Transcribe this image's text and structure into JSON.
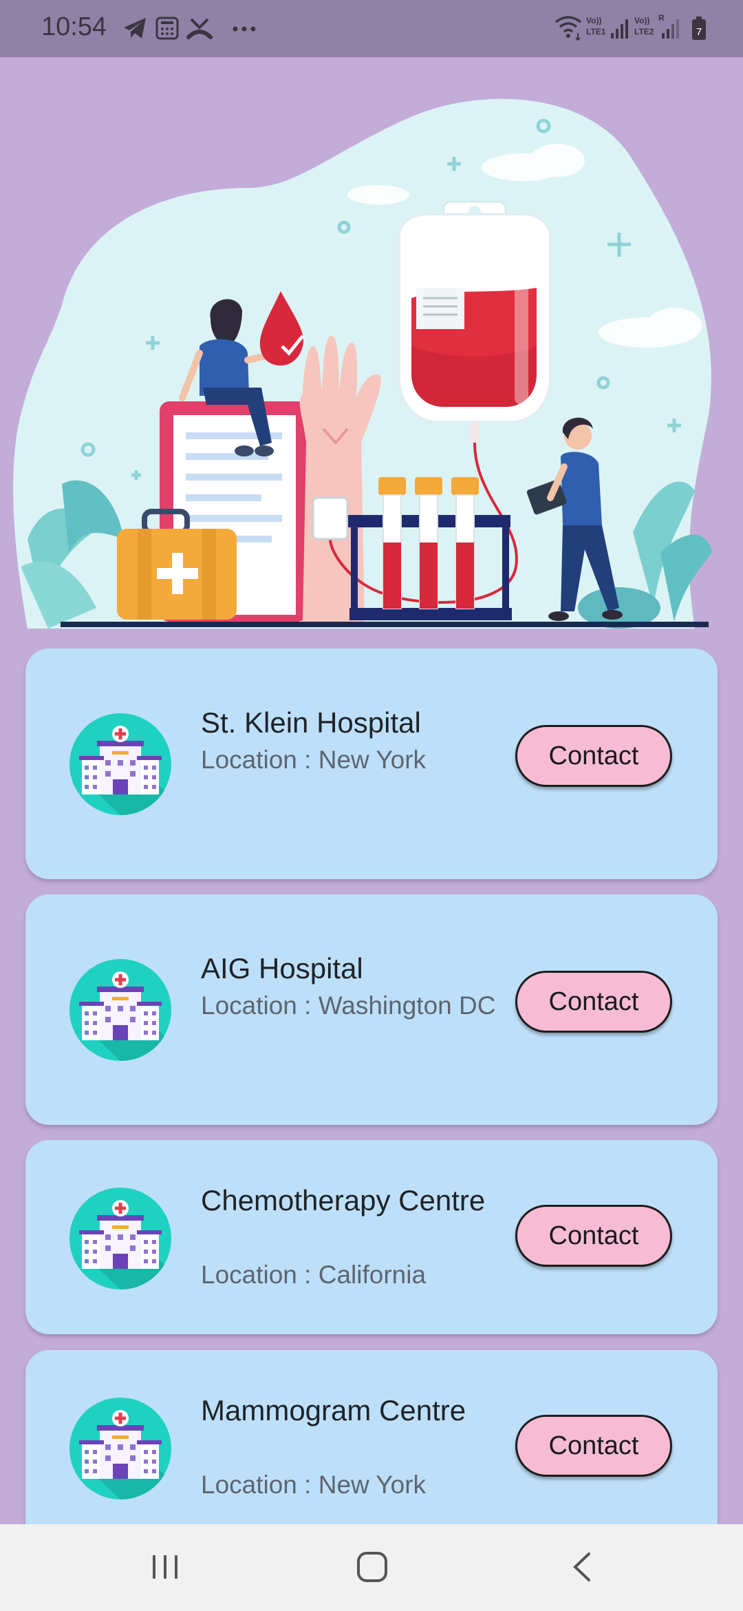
{
  "status_bar": {
    "time": "10:54",
    "left_icons": [
      "telegram-icon",
      "calculator-icon",
      "missed-call-icon",
      "more-dots-icon"
    ],
    "right_icons": [
      "wifi-icon",
      "lte1-signal-icon",
      "lte2-signal-icon",
      "battery-charging-icon"
    ],
    "lte1_label": "LTE1",
    "lte2_label": "LTE2",
    "volte_label": "Vo))",
    "roaming_label": "R",
    "battery_level": "7"
  },
  "hero": {
    "illustration": "blood-donation-illustration"
  },
  "hospitals": [
    {
      "name": "St. Klein Hospital",
      "location": "Location : New York",
      "contact_label": "Contact"
    },
    {
      "name": "AIG Hospital",
      "location": "Location : Washington DC",
      "contact_label": "Contact"
    },
    {
      "name": "Chemotherapy Centre",
      "location": "Location : California",
      "contact_label": "Contact"
    },
    {
      "name": "Mammogram Centre",
      "location": "Location : New York",
      "contact_label": "Contact"
    }
  ],
  "nav_bar": {
    "icons": [
      "recent-apps-icon",
      "home-icon",
      "back-icon"
    ]
  },
  "colors": {
    "background": "#c3add8",
    "card": "#bedff9",
    "contact_button": "#f7bcd4",
    "icon_circle": "#1fd1c1"
  }
}
